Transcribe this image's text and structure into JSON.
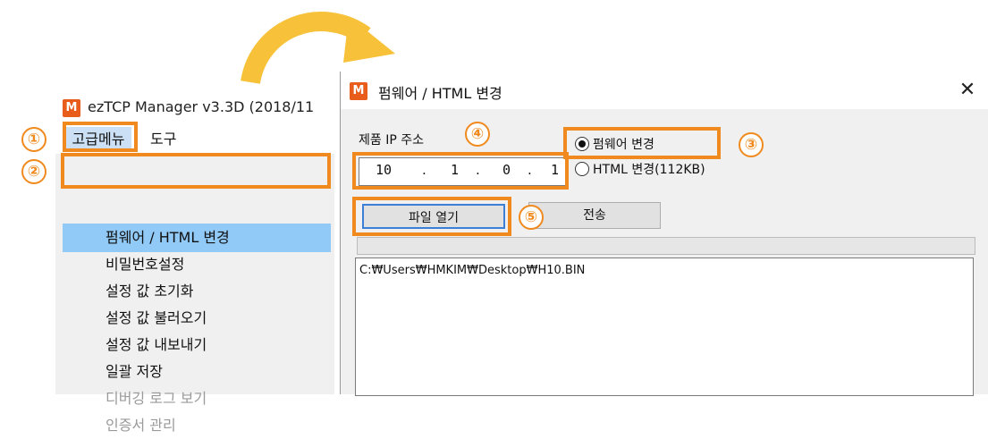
{
  "left_window": {
    "title": "ezTCP Manager v3.3D (2018/11",
    "icon_letter": "M",
    "menu": {
      "advanced": "고급메뉴",
      "tools": "도구"
    },
    "dropdown": [
      {
        "label": "펌웨어 / HTML 변경",
        "enabled": true
      },
      {
        "label": "비밀번호설정",
        "enabled": true
      },
      {
        "label": "설정 값 초기화",
        "enabled": true
      },
      {
        "label": "설정 값 불러오기",
        "enabled": true
      },
      {
        "label": "설정 값 내보내기",
        "enabled": true
      },
      {
        "label": "일괄 저장",
        "enabled": true
      },
      {
        "label": "디버깅 로그 보기",
        "enabled": false
      },
      {
        "label": "인증서 관리",
        "enabled": false
      }
    ]
  },
  "dialog": {
    "title": "펌웨어 / HTML 변경",
    "icon_letter": "M",
    "close_symbol": "✕",
    "ip_label": "제품 IP 주소",
    "ip_octets": [
      "10",
      "1",
      "0",
      "1"
    ],
    "radio_firmware": {
      "label": "펌웨어 변경",
      "selected": true
    },
    "radio_html": {
      "label": "HTML 변경(112KB)",
      "selected": false
    },
    "open_button": "파일 열기",
    "send_button": "전송",
    "progress": 0,
    "file_path": "C:₩Users₩HMKIM₩Desktop₩H10.BIN"
  },
  "markers": [
    "①",
    "②",
    "③",
    "④",
    "⑤"
  ],
  "colors": {
    "highlight": "#f08a1e",
    "arrow": "#f7c23a",
    "menu_selected": "#91c9f7",
    "icon": "#e85c1c"
  }
}
